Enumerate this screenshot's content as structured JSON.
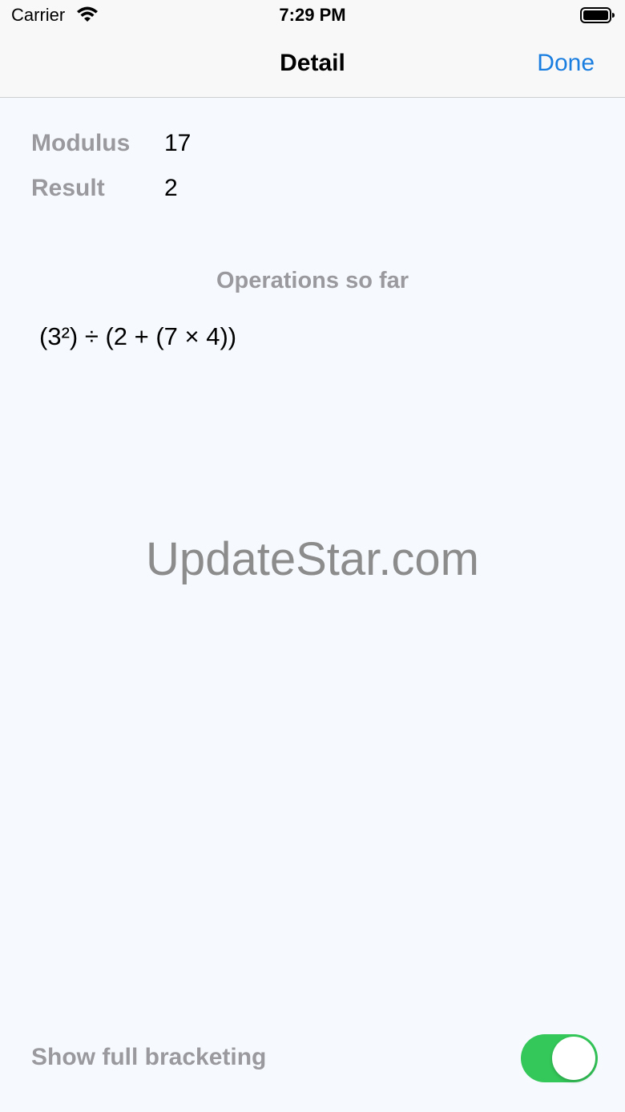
{
  "status_bar": {
    "carrier": "Carrier",
    "time": "7:29 PM",
    "wifi_icon": "wifi-icon",
    "battery_icon": "battery-full-icon"
  },
  "nav_bar": {
    "title": "Detail",
    "done_label": "Done"
  },
  "info": {
    "modulus_label": "Modulus",
    "modulus_value": "17",
    "result_label": "Result",
    "result_value": "2"
  },
  "operations": {
    "title": "Operations so far",
    "expression": "(3²) ÷ (2 + (7 × 4))"
  },
  "watermark": "UpdateStar.com",
  "settings": {
    "bracketing_label": "Show full bracketing",
    "bracketing_on": true
  },
  "colors": {
    "accent": "#1a7ee0",
    "toggle_on": "#34c759",
    "label_gray": "#9a9a9e",
    "background": "#f6fafe"
  }
}
